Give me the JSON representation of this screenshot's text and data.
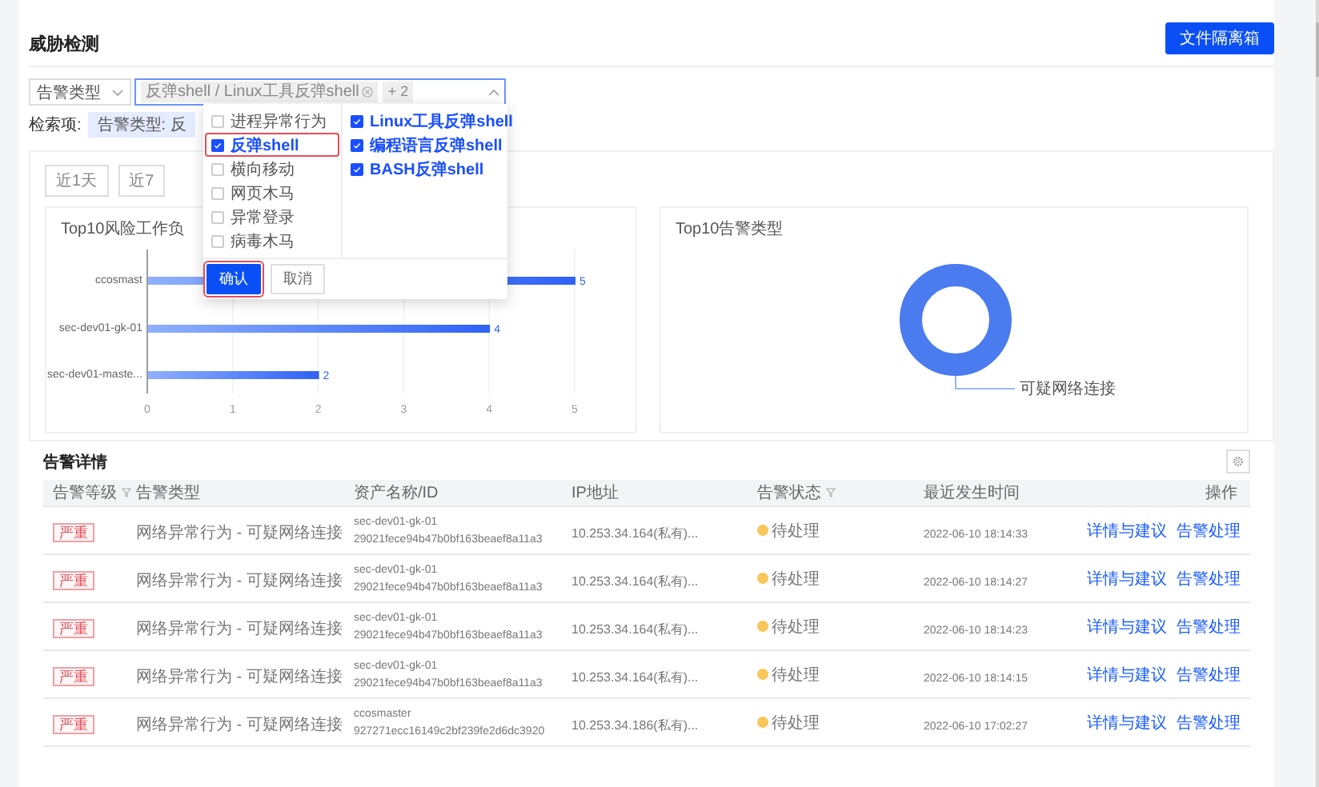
{
  "header": {
    "title": "威胁检测",
    "button": "文件隔离箱"
  },
  "filters": {
    "type_select": {
      "value": "告警类型"
    },
    "multi_select": {
      "tag": "反弹shell / Linux工具反弹shell",
      "more": "+ 2",
      "expanded": true
    }
  },
  "search": {
    "label": "检索项:",
    "chips": [
      "告警类型: 反"
    ]
  },
  "dropdown": {
    "columns": [
      [
        {
          "label": "进程异常行为",
          "checked": false,
          "highlighted": false
        },
        {
          "label": "反弹shell",
          "checked": true,
          "highlighted": true
        },
        {
          "label": "横向移动",
          "checked": false,
          "highlighted": false
        },
        {
          "label": "网页木马",
          "checked": false,
          "highlighted": false
        },
        {
          "label": "异常登录",
          "checked": false,
          "highlighted": false
        },
        {
          "label": "病毒木马",
          "checked": false,
          "highlighted": false
        }
      ],
      [
        {
          "label": "Linux工具反弹shell",
          "checked": true,
          "highlighted": false
        },
        {
          "label": "编程语言反弹shell",
          "checked": true,
          "highlighted": false
        },
        {
          "label": "BASH反弹shell",
          "checked": true,
          "highlighted": false
        }
      ]
    ],
    "buttons": [
      {
        "label": "确认",
        "kind": "primary",
        "highlighted": true
      },
      {
        "label": "取消",
        "kind": "default",
        "highlighted": false
      }
    ]
  },
  "time_buttons": [
    {
      "label": "近1天",
      "selected": false
    },
    {
      "label": "近7",
      "selected": false
    }
  ],
  "bar_panel": {
    "chart_data": {
      "type": "bar",
      "orientation": "horizontal",
      "title": "Top10风险工作负",
      "categories": [
        "ccosmast",
        "sec-dev01-gk-01",
        "sec-dev01-maste..."
      ],
      "values": [
        5,
        4,
        2
      ],
      "xticks": [
        0,
        1,
        2,
        3,
        4,
        5
      ],
      "xlim": [
        0,
        5
      ],
      "grid": true,
      "data_labels": true
    }
  },
  "donut_panel": {
    "title": "Top10告警类型",
    "label": "可疑网络连接"
  },
  "alerts": {
    "title": "告警详情",
    "columns": [
      {
        "label": "告警等级",
        "filter": true
      },
      {
        "label": "告警类型",
        "filter": false
      },
      {
        "label": "资产名称/ID",
        "filter": false
      },
      {
        "label": "IP地址",
        "filter": false
      },
      {
        "label": "告警状态",
        "filter": true
      },
      {
        "label": "最近发生时间",
        "filter": false
      },
      {
        "label": "操作",
        "filter": false
      }
    ],
    "rows": [
      {
        "level": "严重",
        "type": "网络异常行为 - 可疑网络连接",
        "asset": "sec-dev01-gk-01",
        "id": "29021fece94b47b0bf163beaef8a11a3",
        "ip": "10.253.34.164(私有)...",
        "status": "待处理",
        "time": "2022-06-10 18:14:33",
        "actions": [
          "详情与建议",
          "告警处理"
        ]
      },
      {
        "level": "严重",
        "type": "网络异常行为 - 可疑网络连接",
        "asset": "sec-dev01-gk-01",
        "id": "29021fece94b47b0bf163beaef8a11a3",
        "ip": "10.253.34.164(私有)...",
        "status": "待处理",
        "time": "2022-06-10 18:14:27",
        "actions": [
          "详情与建议",
          "告警处理"
        ]
      },
      {
        "level": "严重",
        "type": "网络异常行为 - 可疑网络连接",
        "asset": "sec-dev01-gk-01",
        "id": "29021fece94b47b0bf163beaef8a11a3",
        "ip": "10.253.34.164(私有)...",
        "status": "待处理",
        "time": "2022-06-10 18:14:23",
        "actions": [
          "详情与建议",
          "告警处理"
        ]
      },
      {
        "level": "严重",
        "type": "网络异常行为 - 可疑网络连接",
        "asset": "sec-dev01-gk-01",
        "id": "29021fece94b47b0bf163beaef8a11a3",
        "ip": "10.253.34.164(私有)...",
        "status": "待处理",
        "time": "2022-06-10 18:14:15",
        "actions": [
          "详情与建议",
          "告警处理"
        ]
      },
      {
        "level": "严重",
        "type": "网络异常行为 - 可疑网络连接",
        "asset": "ccosmaster",
        "id": "927271ecc16149c2bf239fe2d6dc3920",
        "ip": "10.253.34.186(私有)...",
        "status": "待处理",
        "time": "2022-06-10 17:02:27",
        "actions": [
          "详情与建议",
          "告警处理"
        ]
      }
    ]
  }
}
